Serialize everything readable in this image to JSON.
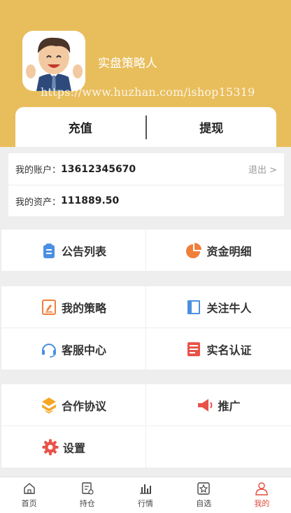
{
  "profile": {
    "username": "实盘策略人",
    "watermark": "https://www.huzhan.com/ishop15319"
  },
  "actions": {
    "recharge": "充值",
    "withdraw": "提现"
  },
  "account": {
    "account_label": "我的账户：",
    "account_value": "13612345670",
    "logout": "退出 >",
    "assets_label": "我的资产：",
    "assets_value": "111889.50"
  },
  "menu": {
    "announcements": "公告列表",
    "funds": "资金明细",
    "strategy": "我的策略",
    "follow": "关注牛人",
    "service": "客服中心",
    "verify": "实名认证",
    "agreement": "合作协议",
    "promote": "推广",
    "settings": "设置"
  },
  "tabs": [
    "首页",
    "持仓",
    "行情",
    "自选",
    "我的"
  ],
  "colors": {
    "header": "#e8be5c",
    "active_tab": "#e04b3a"
  }
}
